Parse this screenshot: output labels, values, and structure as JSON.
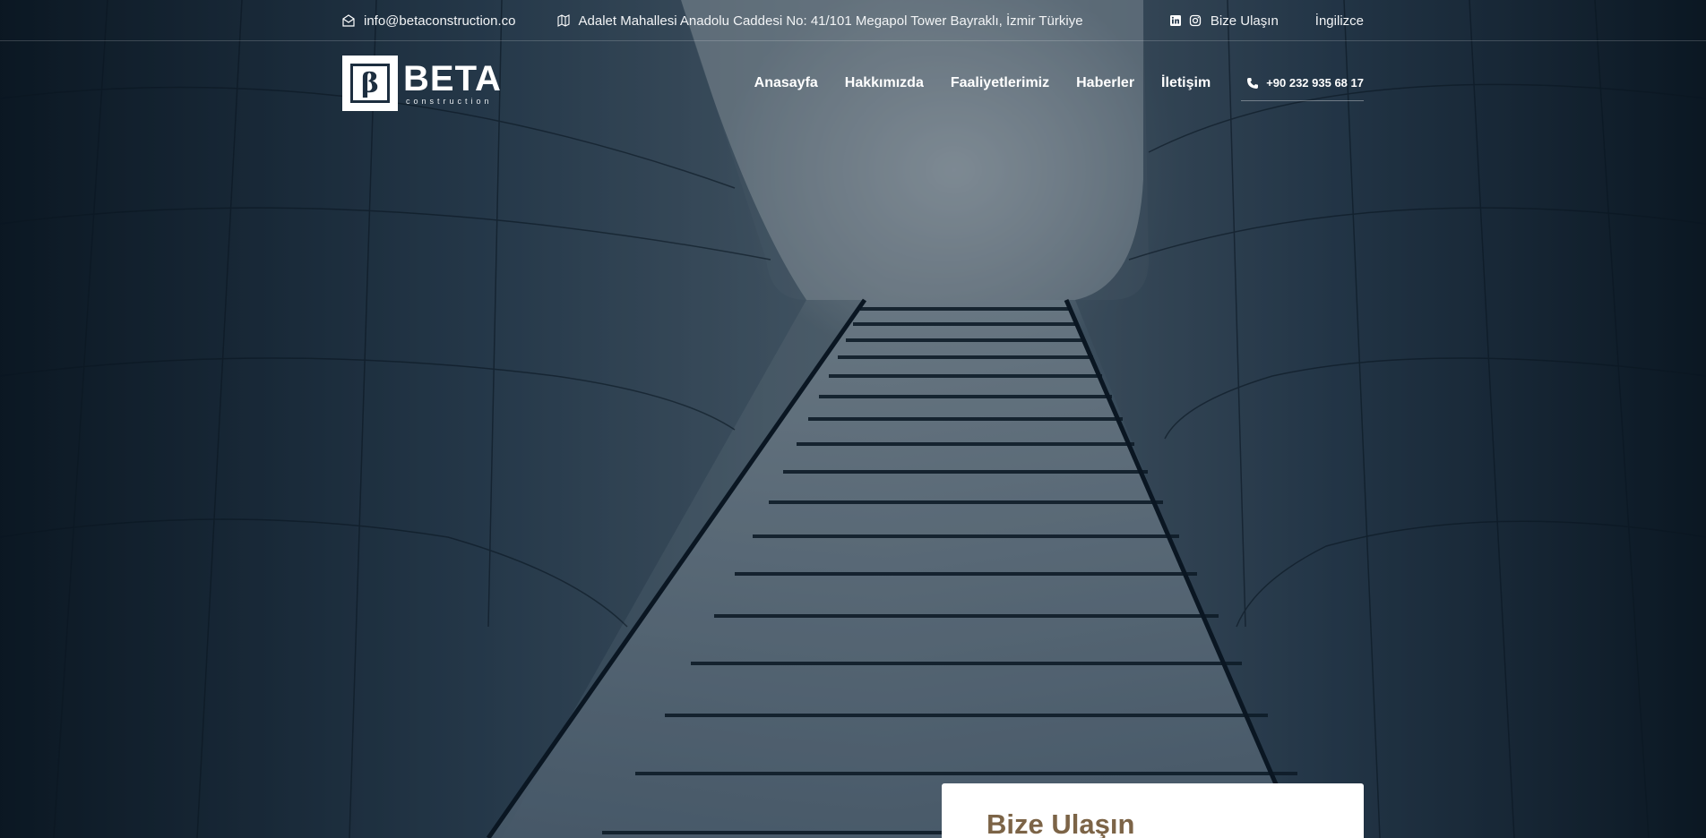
{
  "topbar": {
    "email": "info@betaconstruction.co",
    "address": "Adalet Mahallesi Anadolu Caddesi No: 41/101 Megapol Tower Bayraklı, İzmir Türkiye",
    "contact_link": "Bize Ulaşın",
    "language": "İngilizce"
  },
  "logo": {
    "mark": "β",
    "name": "BETA",
    "sub": "construction"
  },
  "nav": {
    "items": [
      "Anasayfa",
      "Hakkımızda",
      "Faaliyetlerimiz",
      "Haberler",
      "İletişim"
    ],
    "phone": "+90 232 935 68 17"
  },
  "contact_card": {
    "title": "Bize Ulaşın"
  },
  "colors": {
    "accent": "#7c6447",
    "logo_dark": "#1d2e3f"
  },
  "icons": [
    "envelope-icon",
    "map-icon",
    "linkedin-icon",
    "instagram-icon",
    "phone-icon"
  ]
}
